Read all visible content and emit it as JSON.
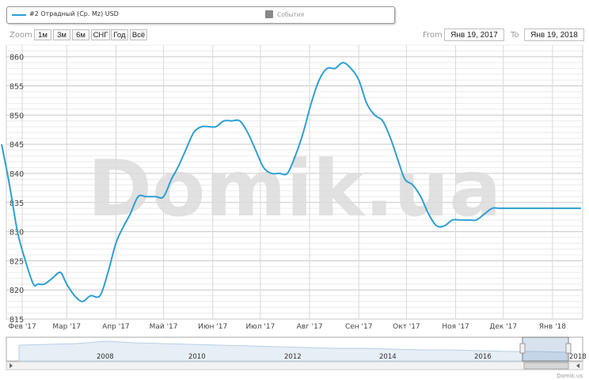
{
  "legend": {
    "series_label": "#2 Отрадный (Ср. Мz) USD",
    "events_label": "События"
  },
  "zoom": {
    "label": "Zoom",
    "buttons": [
      "1м",
      "3м",
      "6м",
      "СНГ",
      "Год",
      "Всё"
    ]
  },
  "range": {
    "from_label": "From",
    "from_value": "Янв 19, 2017",
    "to_label": "To",
    "to_value": "Янв 19, 2018"
  },
  "watermark": "Domik.ua",
  "credit": "Domik.us",
  "colors": {
    "series": "#2f9fd3",
    "grid": "#d8d8d8",
    "watermark": "#dcdcdc"
  },
  "chart_data": {
    "type": "line",
    "title": "",
    "xlabel": "",
    "ylabel": "",
    "ylim": [
      815,
      862
    ],
    "yticks": [
      815,
      820,
      825,
      830,
      835,
      840,
      845,
      850,
      855,
      860
    ],
    "xticks": [
      "Фев '17",
      "Мар '17",
      "Апр '17",
      "Май '17",
      "Июн '17",
      "Июл '17",
      "Авг '17",
      "Сен '17",
      "Окт '17",
      "Ноя '17",
      "Дек '17",
      "Янв '18"
    ],
    "series": [
      {
        "name": "#2 Отрадный (Ср. Мz) USD",
        "color": "#2f9fd3",
        "x": [
          "2017-01-19",
          "2017-01-24",
          "2017-01-29",
          "2017-02-03",
          "2017-02-08",
          "2017-02-11",
          "2017-02-15",
          "2017-02-20",
          "2017-02-25",
          "2017-03-01",
          "2017-03-06",
          "2017-03-11",
          "2017-03-16",
          "2017-03-22",
          "2017-03-27",
          "2017-04-01",
          "2017-04-06",
          "2017-04-10",
          "2017-04-15",
          "2017-04-20",
          "2017-04-26",
          "2017-05-01",
          "2017-05-06",
          "2017-05-10",
          "2017-05-15",
          "2017-05-20",
          "2017-05-25",
          "2017-05-30",
          "2017-06-03",
          "2017-06-08",
          "2017-06-13",
          "2017-06-18",
          "2017-06-23",
          "2017-06-28",
          "2017-07-03",
          "2017-07-08",
          "2017-07-13",
          "2017-07-18",
          "2017-07-23",
          "2017-07-28",
          "2017-08-02",
          "2017-08-07",
          "2017-08-12",
          "2017-08-17",
          "2017-08-22",
          "2017-08-27",
          "2017-09-01",
          "2017-09-06",
          "2017-09-11",
          "2017-09-16",
          "2017-09-21",
          "2017-09-26",
          "2017-09-30",
          "2017-10-05",
          "2017-10-10",
          "2017-10-15",
          "2017-10-20",
          "2017-10-25",
          "2017-10-30",
          "2017-11-04",
          "2017-11-09",
          "2017-11-14",
          "2017-11-19",
          "2017-11-24",
          "2017-11-29",
          "2017-12-04",
          "2017-12-08",
          "2017-12-13",
          "2017-12-18",
          "2017-12-23",
          "2017-12-28",
          "2018-01-02",
          "2018-01-07",
          "2018-01-12",
          "2018-01-19"
        ],
        "values": [
          845,
          838,
          830,
          825,
          821,
          821,
          821,
          822,
          823,
          821,
          819,
          818,
          819,
          819,
          823,
          828,
          831,
          833,
          836,
          836,
          836,
          836,
          839,
          841,
          844,
          847,
          848,
          848,
          848,
          849,
          849,
          849,
          847,
          844,
          841,
          840,
          840,
          840,
          843,
          847,
          852,
          856,
          858,
          858,
          859,
          858,
          856,
          852,
          850,
          849,
          846,
          842,
          839,
          838,
          836,
          833,
          831,
          831,
          832,
          832,
          832,
          832,
          833,
          834,
          834,
          834,
          834,
          834,
          834,
          834,
          834,
          834,
          834,
          834,
          834
        ]
      }
    ]
  },
  "navigator": {
    "labels": [
      "2008",
      "2010",
      "2012",
      "2014",
      "2016",
      "2018"
    ],
    "line_values": [
      20,
      21,
      22,
      25,
      23,
      22,
      21,
      20,
      19,
      18,
      17,
      16,
      16,
      15,
      14,
      14,
      13,
      12,
      12,
      11
    ]
  }
}
